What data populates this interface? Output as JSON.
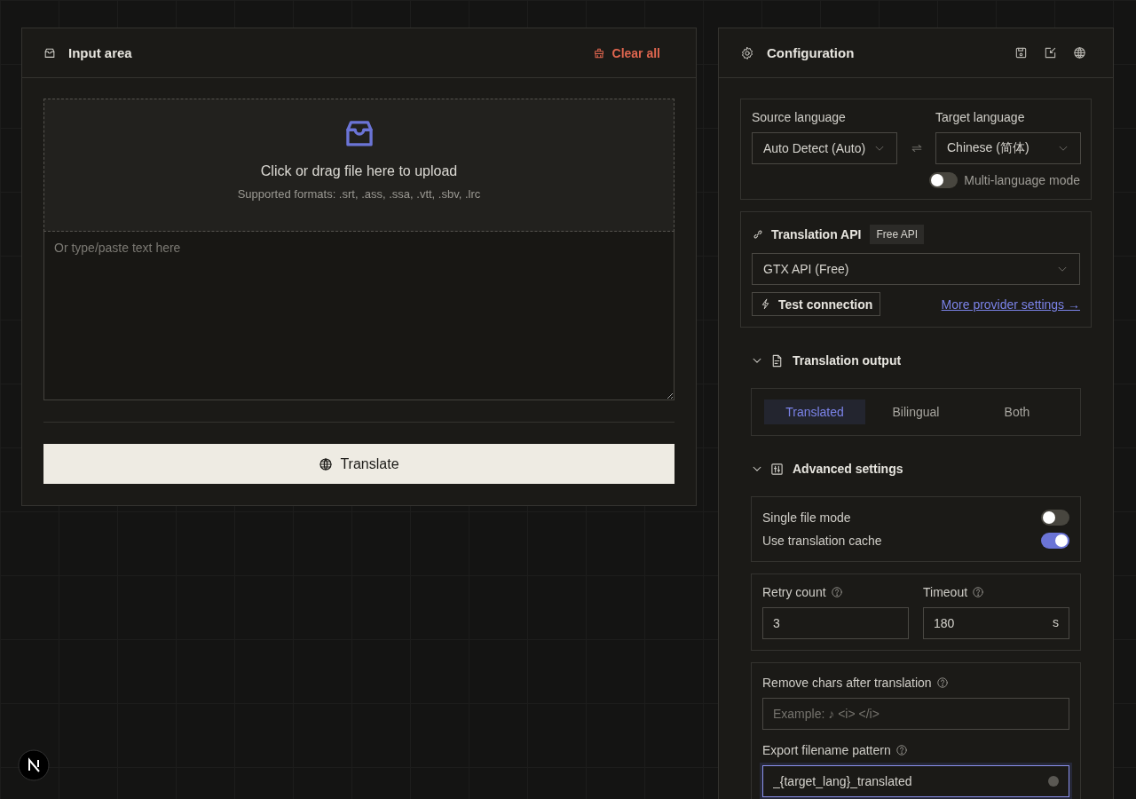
{
  "input_panel": {
    "title": "Input area",
    "clear_button": "Clear all",
    "upload": {
      "title": "Click or drag file here to upload",
      "formats": "Supported formats: .srt, .ass, .ssa, .vtt, .sbv, .lrc"
    },
    "text_area": {
      "placeholder": "Or type/paste text here"
    },
    "translate_button": "Translate"
  },
  "config_panel": {
    "title": "Configuration",
    "languages": {
      "source_label": "Source language",
      "source_value": "Auto Detect (Auto)",
      "target_label": "Target language",
      "target_value": "Chinese (简体)",
      "multi_language": {
        "label": "Multi-language mode",
        "on": false
      }
    },
    "api": {
      "title": "Translation API",
      "badge": "Free API",
      "provider": "GTX API (Free)",
      "test_button": "Test connection",
      "more_link": "More provider settings →"
    },
    "output": {
      "title": "Translation output",
      "expanded": true,
      "options": [
        {
          "label": "Translated",
          "selected": true
        },
        {
          "label": "Bilingual",
          "selected": false
        },
        {
          "label": "Both",
          "selected": false
        }
      ]
    },
    "advanced": {
      "title": "Advanced settings",
      "expanded": true,
      "toggles": [
        {
          "label": "Single file mode",
          "on": false
        },
        {
          "label": "Use translation cache",
          "on": true
        }
      ],
      "retry": {
        "label": "Retry count",
        "value": "3"
      },
      "timeout": {
        "label": "Timeout",
        "value": "180",
        "unit": "s"
      },
      "remove_chars": {
        "label": "Remove chars after translation",
        "placeholder": "Example: ♪ <i> </i>"
      },
      "filename_pattern": {
        "label": "Export filename pattern",
        "value": "_{target_lang}_translated",
        "focused": true
      }
    }
  }
}
